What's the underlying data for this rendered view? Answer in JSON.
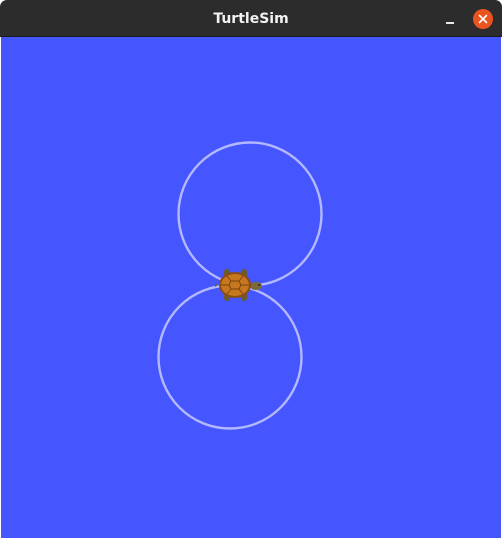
{
  "window": {
    "title": "TurtleSim",
    "background_color": "#4556ff",
    "titlebar_color": "#2c2c2c",
    "close_button_color": "#e95420",
    "trail_color": "#b4b8ff"
  },
  "controls": {
    "minimize_icon": "minimize-icon",
    "close_icon": "close-icon"
  },
  "turtle": {
    "icon": "turtle-icon",
    "shell_color": "#b86a1c",
    "body_color": "#6b5a2a"
  }
}
